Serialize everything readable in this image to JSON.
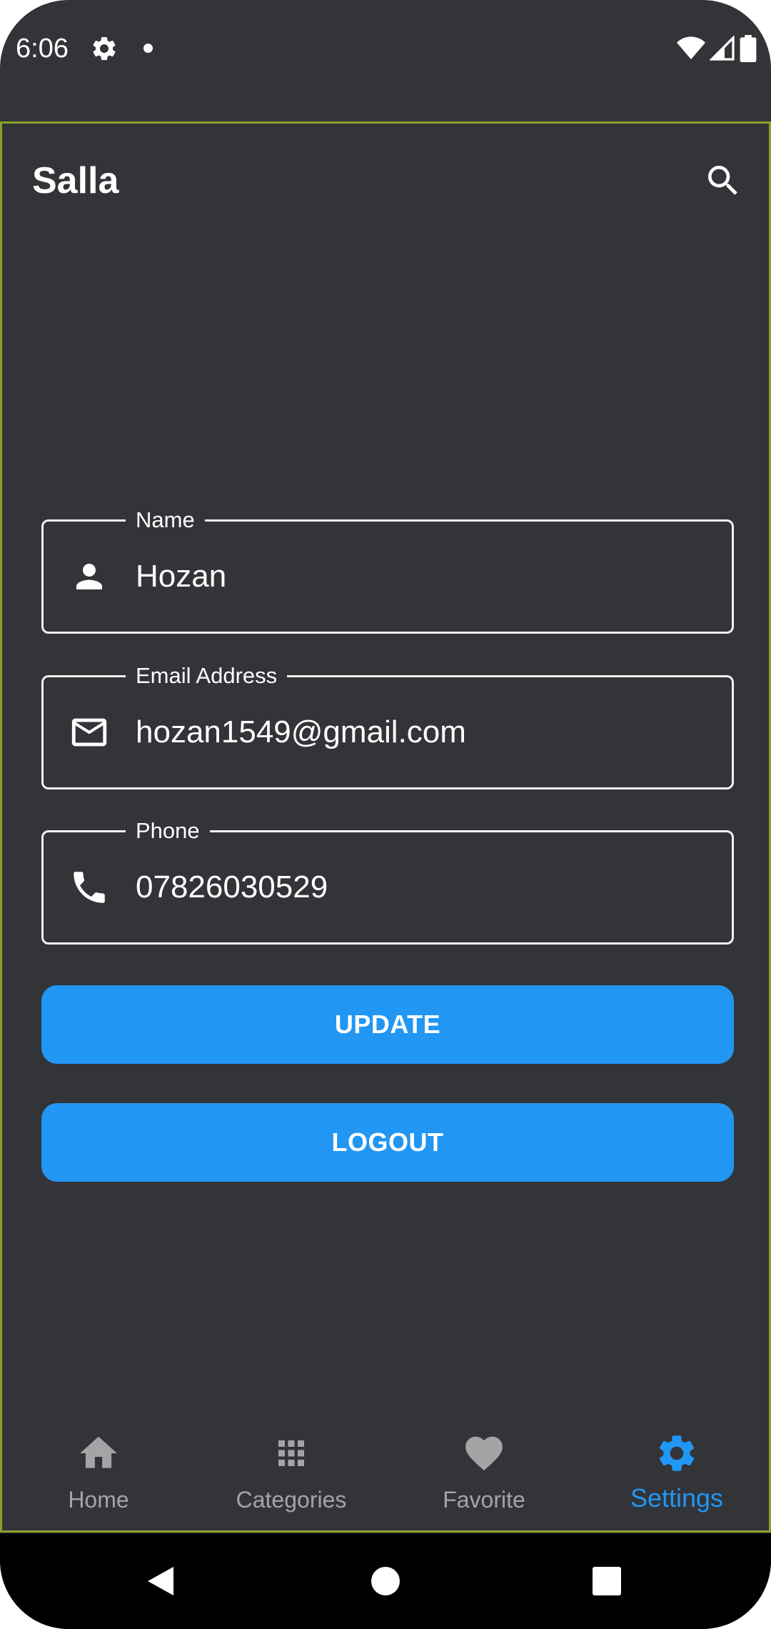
{
  "status_bar": {
    "time": "6:06",
    "icons": [
      "settings-icon",
      "notification-dot",
      "wifi-icon",
      "signal-icon",
      "battery-icon"
    ]
  },
  "appbar": {
    "title": "Salla",
    "search_icon": "search-icon"
  },
  "form": {
    "name": {
      "label": "Name",
      "value": "Hozan",
      "icon": "person-icon"
    },
    "email": {
      "label": "Email Address",
      "value": "hozan1549@gmail.com",
      "icon": "mail-icon"
    },
    "phone": {
      "label": "Phone",
      "value": "07826030529",
      "icon": "phone-icon"
    }
  },
  "buttons": {
    "update": "UPDATE",
    "logout": "LOGOUT"
  },
  "bottom_nav": {
    "items": [
      {
        "label": "Home",
        "icon": "home-icon",
        "active": false
      },
      {
        "label": "Categories",
        "icon": "grid-icon",
        "active": false
      },
      {
        "label": "Favorite",
        "icon": "heart-icon",
        "active": false
      },
      {
        "label": "Settings",
        "icon": "gear-icon",
        "active": true
      }
    ]
  },
  "system_nav": {
    "icons": [
      "back-icon",
      "home-circle-icon",
      "recents-icon"
    ]
  },
  "colors": {
    "background": "#323438",
    "accent": "#2196f3",
    "text": "#ffffff",
    "inactive": "#a3a4a6",
    "frame_border": "#8aa12a"
  }
}
